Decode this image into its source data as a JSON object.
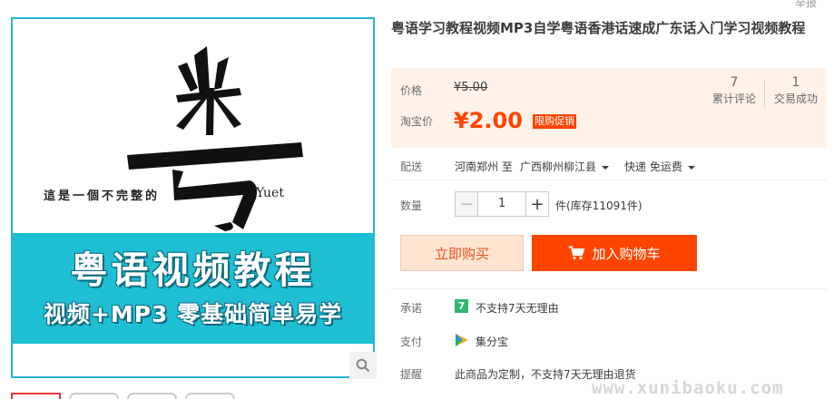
{
  "product": {
    "title": "粤语学习教程视频MP3自学粤语香港话速成广东话入门学习视频教程",
    "report_label": "举报",
    "image": {
      "big_character": "粤",
      "tagline_left": "這是一個不完整的",
      "tagline_right": "Yuet",
      "banner_title": "粤语视频教程",
      "banner_sub": "视频+MP3 零基础简单易学",
      "accent_color": "#22b8d1"
    }
  },
  "price": {
    "label": "价格",
    "original": "¥5.00",
    "taobao_label": "淘宝价",
    "promo": "¥2.00",
    "promo_tag": "限购促销",
    "accent_color": "#ff4400"
  },
  "stats": {
    "reviews_count": "7",
    "reviews_label": "累计评论",
    "deals_count": "1",
    "deals_label": "交易成功"
  },
  "shipping": {
    "label": "配送",
    "route": "河南郑州 至",
    "destination": "广西柳州柳江县",
    "method": "快递 免运费"
  },
  "quantity": {
    "label": "数量",
    "minus": "−",
    "value": "1",
    "plus": "+",
    "stock": "件(库存11091件)"
  },
  "actions": {
    "buy_now": "立即购买",
    "add_cart": "加入购物车"
  },
  "promise": {
    "label": "承诺",
    "badge": "7",
    "text": "不支持7天无理由"
  },
  "payment": {
    "label": "支付",
    "text": "集分宝"
  },
  "reminder": {
    "label": "提醒",
    "text": "此商品为定制，不支持7天无理由退货"
  },
  "watermark": "www.xunibaoku.com"
}
